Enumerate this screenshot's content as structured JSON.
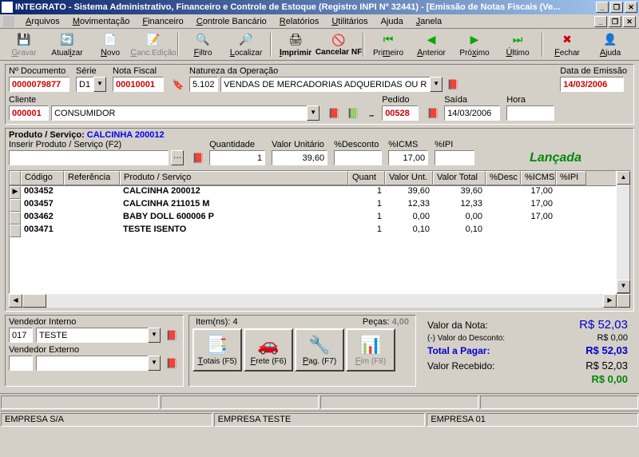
{
  "app": {
    "title": "INTEGRATO - Sistema Administrativo, Financeiro e Controle de Estoque (Registro INPI Nº 32441) - [Emissão de Notas Fiscais (Ve..."
  },
  "menu": [
    {
      "label": "Arquivos",
      "u": 0
    },
    {
      "label": "Movimentação",
      "u": 0
    },
    {
      "label": "Financeiro",
      "u": 0
    },
    {
      "label": "Controle Bancário",
      "u": 0
    },
    {
      "label": "Relatórios",
      "u": 0
    },
    {
      "label": "Utilitários",
      "u": 0
    },
    {
      "label": "Ajuda",
      "u": -1
    },
    {
      "label": "Janela",
      "u": 0
    }
  ],
  "toolbar": [
    {
      "label": "Gravar",
      "u": 0,
      "disabled": true,
      "icon": "💾"
    },
    {
      "label": "Atualizar",
      "u": 5,
      "icon": "🔄"
    },
    {
      "label": "Novo",
      "u": 0,
      "icon": "📄"
    },
    {
      "label": "Canc.Edição",
      "u": 0,
      "disabled": true,
      "icon": "📝"
    },
    {
      "label": "",
      "sep": true
    },
    {
      "label": "Filtro",
      "u": 0,
      "icon": "🔍"
    },
    {
      "label": "Localizar",
      "u": 0,
      "icon": "🔎"
    },
    {
      "label": "",
      "sep": true
    },
    {
      "label": "Imprimir",
      "u": 0,
      "bold": true,
      "icon": "🖨"
    },
    {
      "label": "Cancelar NF",
      "u": -1,
      "bold": true,
      "icon": "🚫"
    },
    {
      "label": "",
      "sep": true
    },
    {
      "label": "Primeiro",
      "u": 3,
      "icon": "⏮",
      "color": "#0a0"
    },
    {
      "label": "Anterior",
      "u": 0,
      "icon": "◀",
      "color": "#0a0"
    },
    {
      "label": "Próximo",
      "u": 3,
      "icon": "▶",
      "color": "#0a0"
    },
    {
      "label": "Último",
      "u": 0,
      "icon": "⏭",
      "color": "#0a0"
    },
    {
      "label": "",
      "sep": true
    },
    {
      "label": "Fechar",
      "u": 0,
      "icon": "✖",
      "color": "#c00"
    },
    {
      "label": "Ajuda",
      "u": 0,
      "icon": "👤"
    }
  ],
  "doc": {
    "num_label": "Nº Documento",
    "num": "0000079877",
    "serie_label": "Série",
    "serie": "D1",
    "nf_label": "Nota Fiscal",
    "nf": "00010001",
    "nat_label": "Natureza da Operação",
    "nat_code": "5.102",
    "nat_desc": "VENDAS DE MERCADORIAS ADQUERIDAS OU RECE",
    "emissao_label": "Data de Emissão",
    "emissao": "14/03/2006",
    "cliente_label": "Cliente",
    "cliente_code": "000001",
    "cliente_nome": "CONSUMIDOR",
    "pedido_label": "Pedido",
    "pedido": "00528",
    "saida_label": "Saída",
    "saida": "14/03/2006",
    "hora_label": "Hora",
    "hora": ""
  },
  "prod": {
    "header_pre": "Produto / Serviço: ",
    "header_name": "CALCINHA 200012",
    "insert_label": "Inserir Produto / Serviço (F2)",
    "qtd_label": "Quantidade",
    "qtd": "1",
    "vunit_label": "Valor Unitário",
    "vunit": "39,60",
    "desc_label": "%Desconto",
    "desc": "",
    "icms_label": "%ICMS",
    "icms": "17,00",
    "ipi_label": "%IPI",
    "ipi": "",
    "launched": "Lançada"
  },
  "grid": {
    "cols": [
      "Código",
      "Referência",
      "Produto / Serviço",
      "Quant",
      "Valor Unt.",
      "Valor Total",
      "%Desc",
      "%ICMS",
      "%IPI"
    ],
    "rows": [
      {
        "codigo": "003452",
        "ref": "",
        "prod": "CALCINHA 200012",
        "quant": "1",
        "vunit": "39,60",
        "vtot": "39,60",
        "desc": "",
        "icms": "17,00",
        "ipi": ""
      },
      {
        "codigo": "003457",
        "ref": "",
        "prod": "CALCINHA 211015 M",
        "quant": "1",
        "vunit": "12,33",
        "vtot": "12,33",
        "desc": "",
        "icms": "17,00",
        "ipi": ""
      },
      {
        "codigo": "003462",
        "ref": "",
        "prod": "BABY DOLL  600006 P",
        "quant": "1",
        "vunit": "0,00",
        "vtot": "0,00",
        "desc": "",
        "icms": "17,00",
        "ipi": ""
      },
      {
        "codigo": "003471",
        "ref": "",
        "prod": "TESTE ISENTO",
        "quant": "1",
        "vunit": "0,10",
        "vtot": "0,10",
        "desc": "",
        "icms": "",
        "ipi": ""
      }
    ]
  },
  "vend": {
    "int_label": "Vendedor Interno",
    "int_code": "017",
    "int_nome": "TESTE",
    "ext_label": "Vendedor Externo",
    "ext_code": "",
    "ext_nome": ""
  },
  "items": {
    "itemns_label": "Item(ns):",
    "itemns": "4",
    "pecas_label": "Peças:",
    "pecas": "4,00",
    "btns": [
      {
        "label": "Totais (F5)",
        "icon": "📑"
      },
      {
        "label": "Frete (F6)",
        "icon": "🚗"
      },
      {
        "label": "Pag. (F7)",
        "icon": "🔧"
      },
      {
        "label": "Fim  (F8)",
        "icon": "📊",
        "disabled": true
      }
    ]
  },
  "totals": {
    "valor_label": "Valor da Nota:",
    "valor": "R$ 52,03",
    "desc_label": "(-) Valor do Desconto:",
    "desc": "R$ 0,00",
    "pagar_label": "Total a Pagar:",
    "pagar": "R$ 52,03",
    "receb_label": "Valor Recebido:",
    "receb": "R$ 52,03",
    "troco": "R$ 0,00"
  },
  "status": {
    "cell1": "EMPRESA S/A",
    "cell2": "EMPRESA TESTE",
    "cell3": "EMPRESA 01"
  }
}
